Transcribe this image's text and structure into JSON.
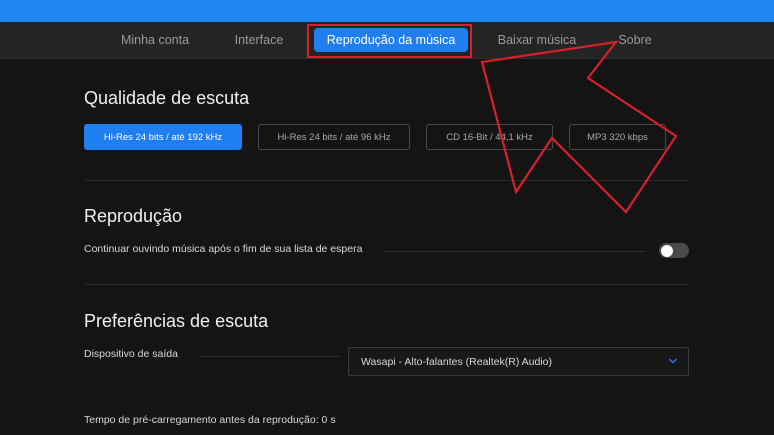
{
  "tabs": [
    {
      "label": "Minha conta"
    },
    {
      "label": "Interface"
    },
    {
      "label": "Reprodução da música"
    },
    {
      "label": "Baixar música"
    },
    {
      "label": "Sobre"
    }
  ],
  "active_tab": "Reprodução da música",
  "quality": {
    "title": "Qualidade de escuta",
    "options": [
      {
        "label": "Hi-Res 24 bits / até 192 kHz"
      },
      {
        "label": "Hi-Res 24 bits / até 96 kHz"
      },
      {
        "label": "CD 16-Bit / 44,1 kHz"
      },
      {
        "label": "MP3 320 kbps"
      }
    ],
    "selected": "Hi-Res 24 bits / até 192 kHz"
  },
  "playback": {
    "title": "Reprodução",
    "continue_label": "Continuar ouvindo música após o fim de sua lista de espera",
    "continue_enabled": false
  },
  "preferences": {
    "title": "Preferências de escuta",
    "output_label": "Dispositivo de saída",
    "output_value": "Wasapi - Alto-falantes (Realtek(R) Audio)",
    "preload_label": "Tempo de pré-carregamento antes da reprodução: 0 s"
  },
  "colors": {
    "accent": "#1f7ef0",
    "annotation": "#d8202a",
    "background": "#141414"
  },
  "icons": {
    "dropdown": "chevron-down-icon",
    "annotation": "arrow-annotation"
  }
}
